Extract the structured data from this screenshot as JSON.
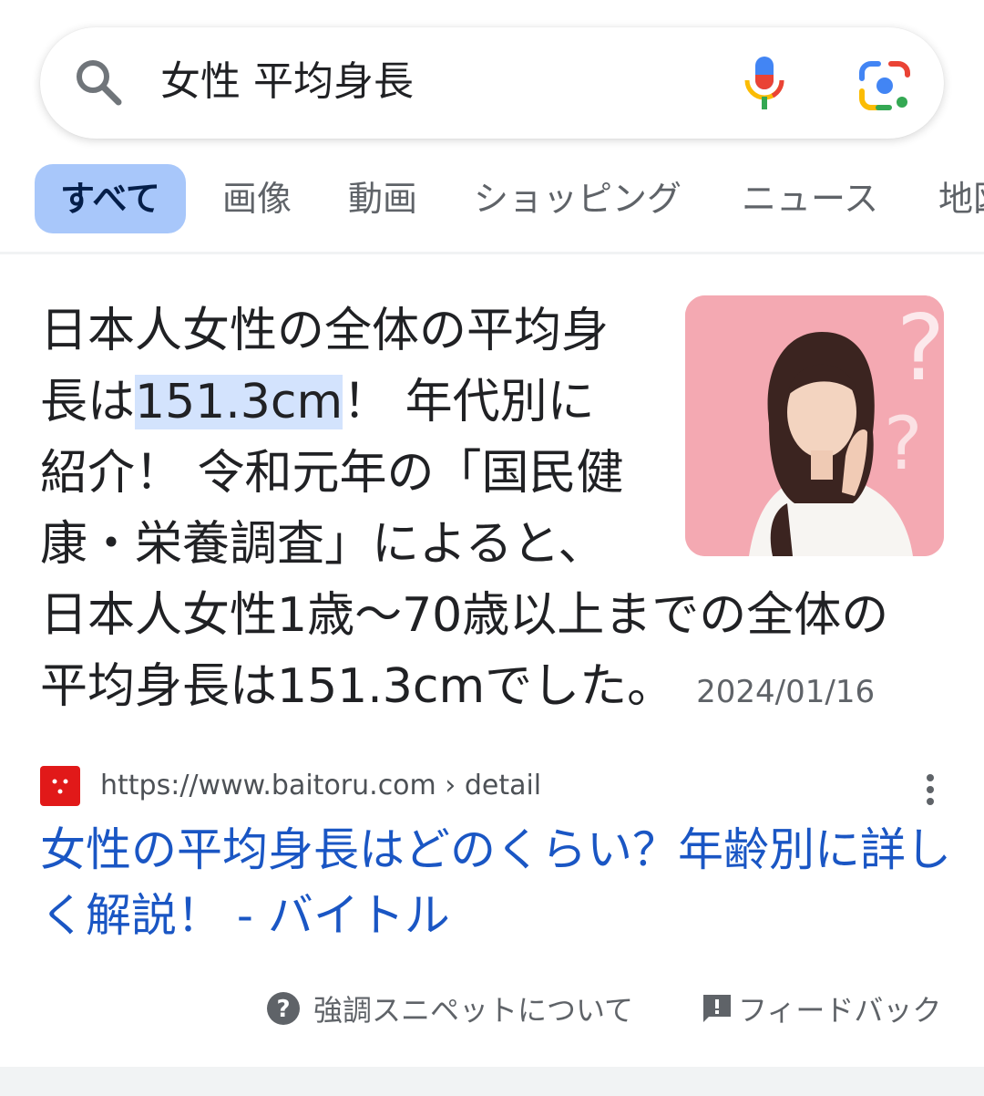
{
  "search": {
    "query": "女性 平均身長",
    "search_icon": "search-icon",
    "mic_icon": "microphone-icon",
    "lens_icon": "camera-lens-icon"
  },
  "tabs": [
    {
      "label": "すべて",
      "active": true
    },
    {
      "label": "画像"
    },
    {
      "label": "動画"
    },
    {
      "label": "ショッピング"
    },
    {
      "label": "ニュース"
    },
    {
      "label": "地図"
    }
  ],
  "snippet": {
    "text_before": "日本人女性の全体の平均身長は",
    "highlight": "151.3cm",
    "text_after": "！ 年代別に紹介！ 令和元年の「国民健康・栄養調査」によると、日本人女性1歳〜70歳以上までの全体の平均身長は151.3cmでした。",
    "date": "2024/01/16",
    "image_icon": "woman-thinking-photo"
  },
  "source": {
    "url": "https://www.baitoru.com › detail",
    "favicon": "baitoru-favicon",
    "more_icon": "more-vert-icon"
  },
  "result": {
    "title": "女性の平均身長はどのくらい？年齢別に詳しく解説！ - バイトル"
  },
  "footer": {
    "about_label": "強調スニペットについて",
    "about_icon": "help-circle-icon",
    "feedback_label": "フィードバック",
    "feedback_icon": "feedback-icon"
  },
  "colors": {
    "link": "#1a56c4",
    "tab_active_bg": "#a8c7fa",
    "highlight_bg": "#d3e3fd",
    "favicon": "#e11919"
  }
}
